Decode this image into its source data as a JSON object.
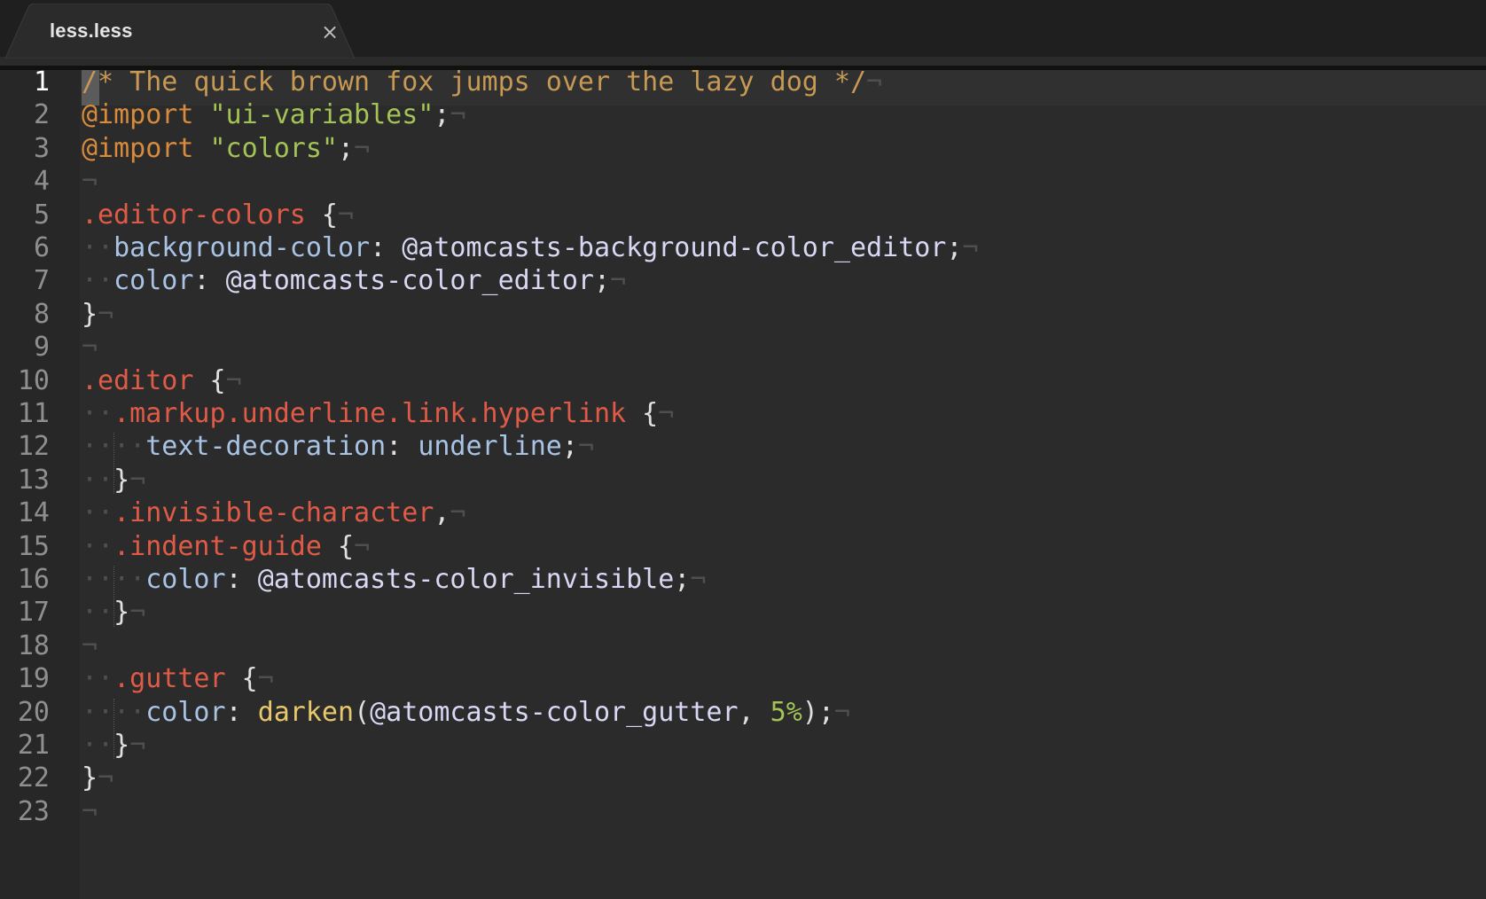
{
  "tab": {
    "title": "less.less",
    "close_glyph": "×"
  },
  "current_line": 1,
  "eol_glyph": "¬",
  "lines": [
    {
      "n": "1",
      "segs": [
        [
          "comment",
          "/* The quick brown fox jumps over the lazy dog */"
        ]
      ]
    },
    {
      "n": "2",
      "segs": [
        [
          "import",
          "@import"
        ],
        [
          "punc",
          " "
        ],
        [
          "string",
          "\"ui-variables\""
        ],
        [
          "punc",
          ";"
        ]
      ]
    },
    {
      "n": "3",
      "segs": [
        [
          "import",
          "@import"
        ],
        [
          "punc",
          " "
        ],
        [
          "string",
          "\"colors\""
        ],
        [
          "punc",
          ";"
        ]
      ]
    },
    {
      "n": "4",
      "segs": []
    },
    {
      "n": "5",
      "segs": [
        [
          "selector",
          ".editor-colors"
        ],
        [
          "punc",
          " {"
        ]
      ]
    },
    {
      "n": "6",
      "segs": [
        [
          "inv",
          "··"
        ],
        [
          "prop",
          "background-color"
        ],
        [
          "punc",
          ": "
        ],
        [
          "var",
          "@atomcasts-background-color_editor"
        ],
        [
          "punc",
          ";"
        ]
      ]
    },
    {
      "n": "7",
      "segs": [
        [
          "inv",
          "··"
        ],
        [
          "prop",
          "color"
        ],
        [
          "punc",
          ": "
        ],
        [
          "var",
          "@atomcasts-color_editor"
        ],
        [
          "punc",
          ";"
        ]
      ]
    },
    {
      "n": "8",
      "segs": [
        [
          "punc",
          "}"
        ]
      ]
    },
    {
      "n": "9",
      "segs": []
    },
    {
      "n": "10",
      "segs": [
        [
          "selector",
          ".editor"
        ],
        [
          "punc",
          " {"
        ]
      ]
    },
    {
      "n": "11",
      "segs": [
        [
          "inv",
          "··"
        ],
        [
          "selector",
          ".markup.underline.link.hyperlink"
        ],
        [
          "punc",
          " {"
        ]
      ]
    },
    {
      "n": "12",
      "segs": [
        [
          "inv",
          "····"
        ],
        [
          "prop",
          "text-decoration"
        ],
        [
          "punc",
          ": "
        ],
        [
          "prop",
          "underline"
        ],
        [
          "punc",
          ";"
        ]
      ]
    },
    {
      "n": "13",
      "segs": [
        [
          "inv",
          "··"
        ],
        [
          "punc",
          "}"
        ]
      ]
    },
    {
      "n": "14",
      "segs": [
        [
          "inv",
          "··"
        ],
        [
          "selector",
          ".invisible-character"
        ],
        [
          "punc",
          ","
        ]
      ]
    },
    {
      "n": "15",
      "segs": [
        [
          "inv",
          "··"
        ],
        [
          "selector",
          ".indent-guide"
        ],
        [
          "punc",
          " {"
        ]
      ]
    },
    {
      "n": "16",
      "segs": [
        [
          "inv",
          "····"
        ],
        [
          "prop",
          "color"
        ],
        [
          "punc",
          ": "
        ],
        [
          "var",
          "@atomcasts-color_invisible"
        ],
        [
          "punc",
          ";"
        ]
      ]
    },
    {
      "n": "17",
      "segs": [
        [
          "inv",
          "··"
        ],
        [
          "punc",
          "}"
        ]
      ]
    },
    {
      "n": "18",
      "segs": []
    },
    {
      "n": "19",
      "segs": [
        [
          "inv",
          "··"
        ],
        [
          "selector",
          ".gutter"
        ],
        [
          "punc",
          " {"
        ]
      ]
    },
    {
      "n": "20",
      "segs": [
        [
          "inv",
          "····"
        ],
        [
          "prop",
          "color"
        ],
        [
          "punc",
          ": "
        ],
        [
          "func",
          "darken"
        ],
        [
          "punc",
          "("
        ],
        [
          "var",
          "@atomcasts-color_gutter"
        ],
        [
          "punc",
          ", "
        ],
        [
          "num",
          "5%"
        ],
        [
          "punc",
          ");"
        ]
      ]
    },
    {
      "n": "21",
      "segs": [
        [
          "inv",
          "··"
        ],
        [
          "punc",
          "}"
        ]
      ]
    },
    {
      "n": "22",
      "segs": [
        [
          "punc",
          "}"
        ]
      ]
    },
    {
      "n": "23",
      "segs": []
    }
  ]
}
